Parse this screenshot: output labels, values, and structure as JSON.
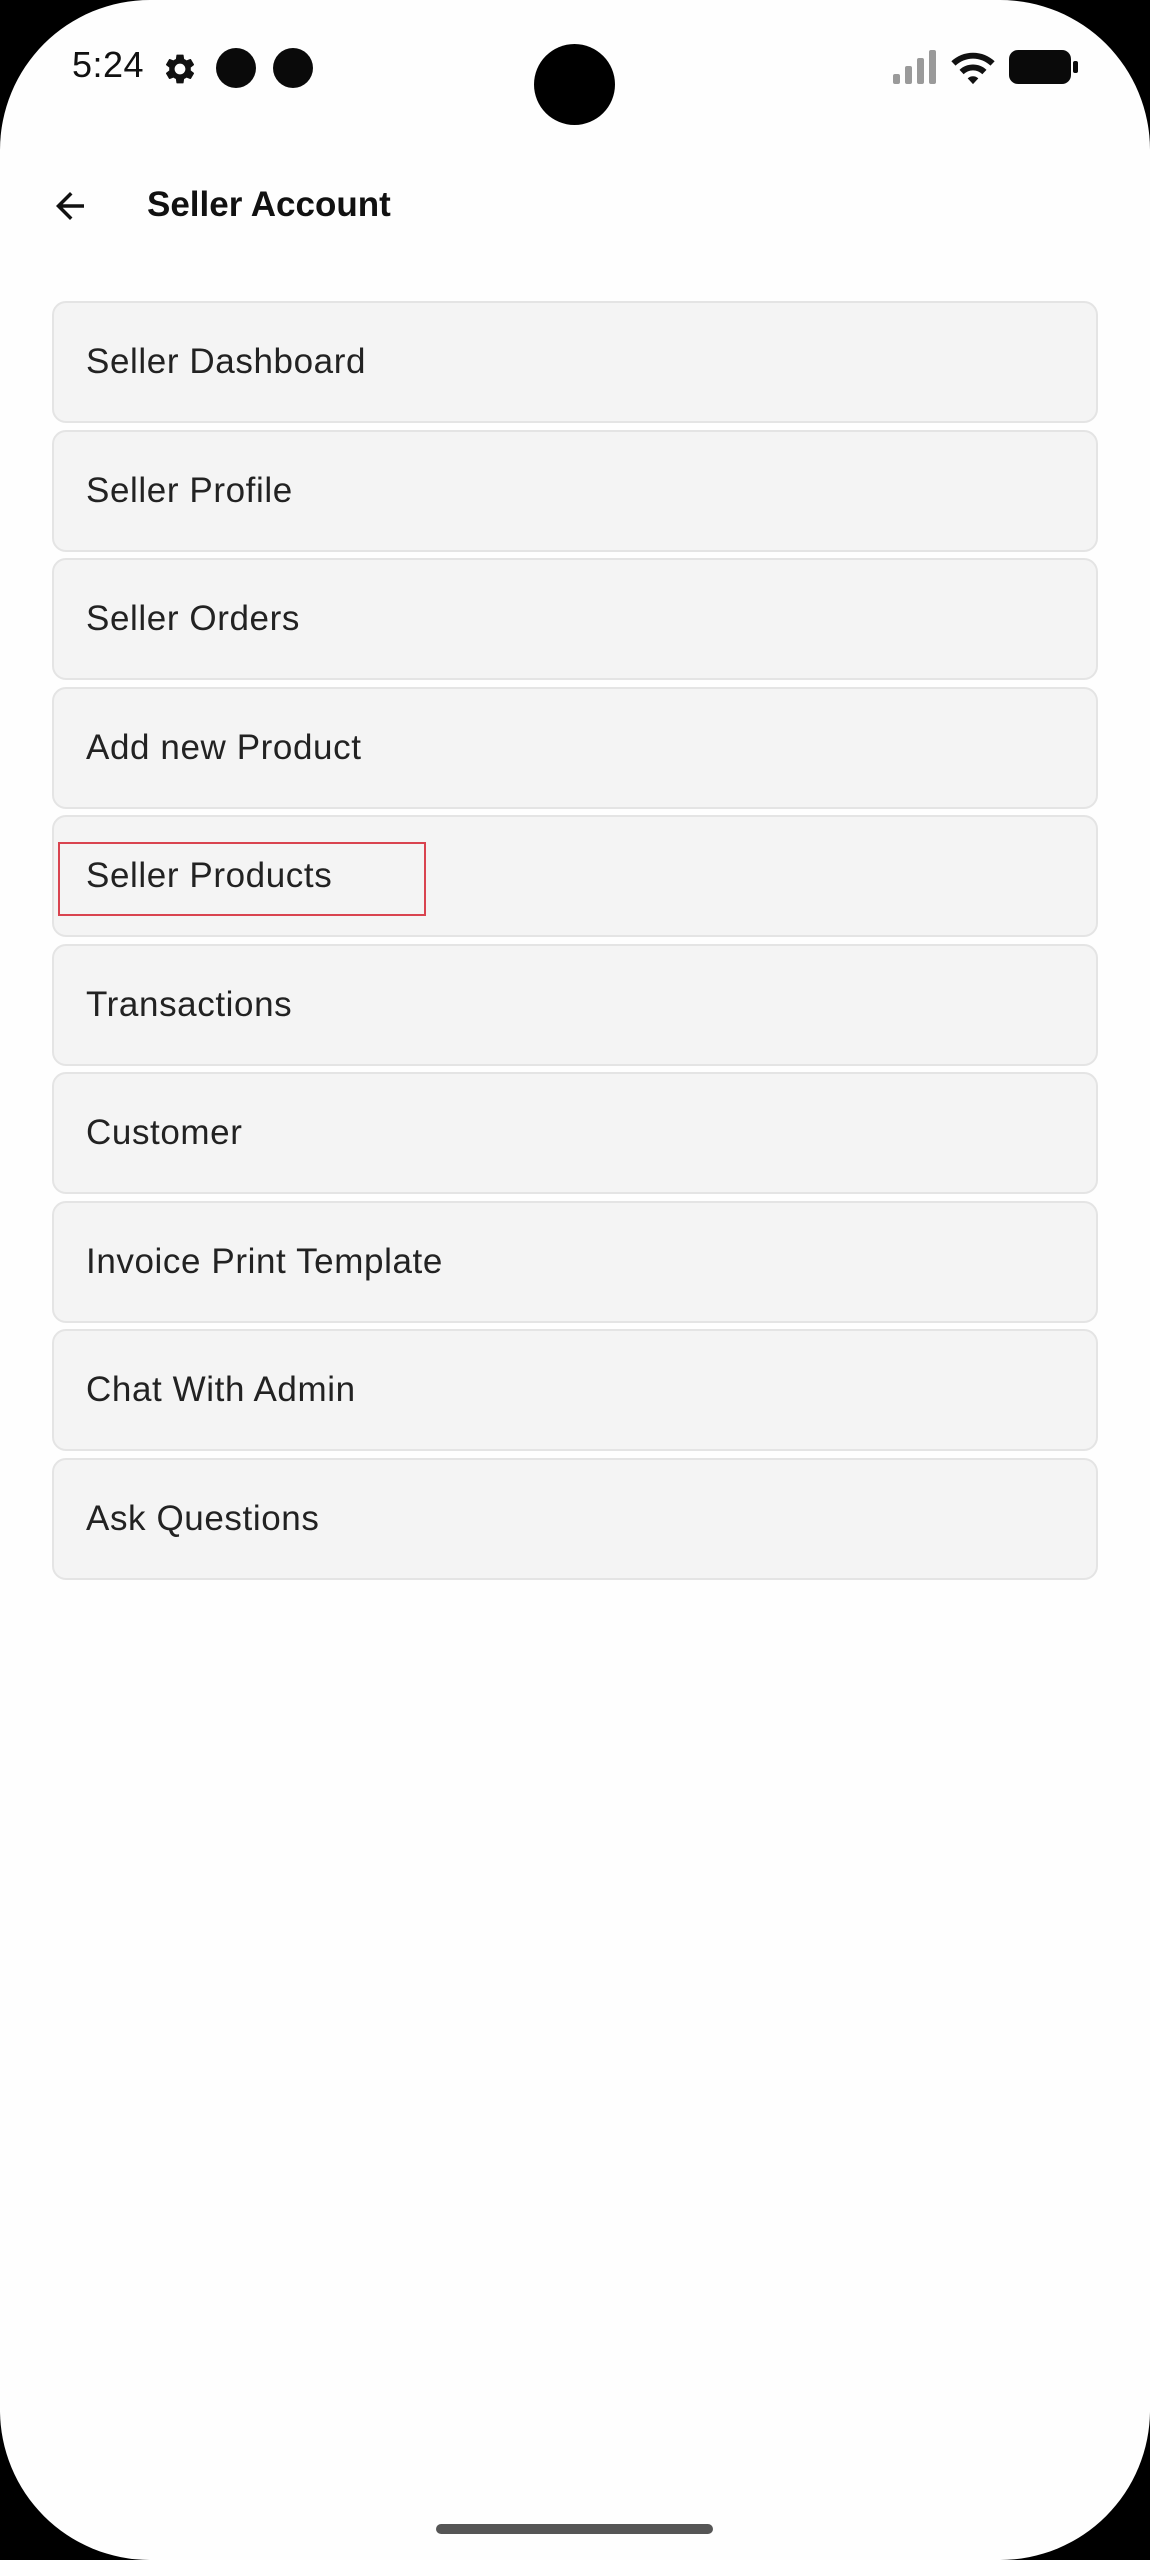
{
  "status_bar": {
    "time": "5:24",
    "icons": [
      "settings-gear-icon",
      "notification-dot-icon",
      "notification-dot-icon",
      "signal-icon",
      "wifi-icon",
      "battery-icon"
    ]
  },
  "app_bar": {
    "back_icon": "arrow-left-icon",
    "title": "Seller Account"
  },
  "menu": {
    "items": [
      {
        "label": "Seller Dashboard"
      },
      {
        "label": "Seller Profile"
      },
      {
        "label": "Seller Orders"
      },
      {
        "label": "Add new Product"
      },
      {
        "label": "Seller Products",
        "highlighted": true
      },
      {
        "label": "Transactions"
      },
      {
        "label": "Customer"
      },
      {
        "label": "Invoice Print Template"
      },
      {
        "label": "Chat With Admin"
      },
      {
        "label": "Ask Questions"
      }
    ]
  },
  "colors": {
    "background": "#fefefe",
    "item_background": "#f4f4f4",
    "item_border": "#e4e4e4",
    "text": "#222222",
    "highlight": "#d9434f"
  }
}
